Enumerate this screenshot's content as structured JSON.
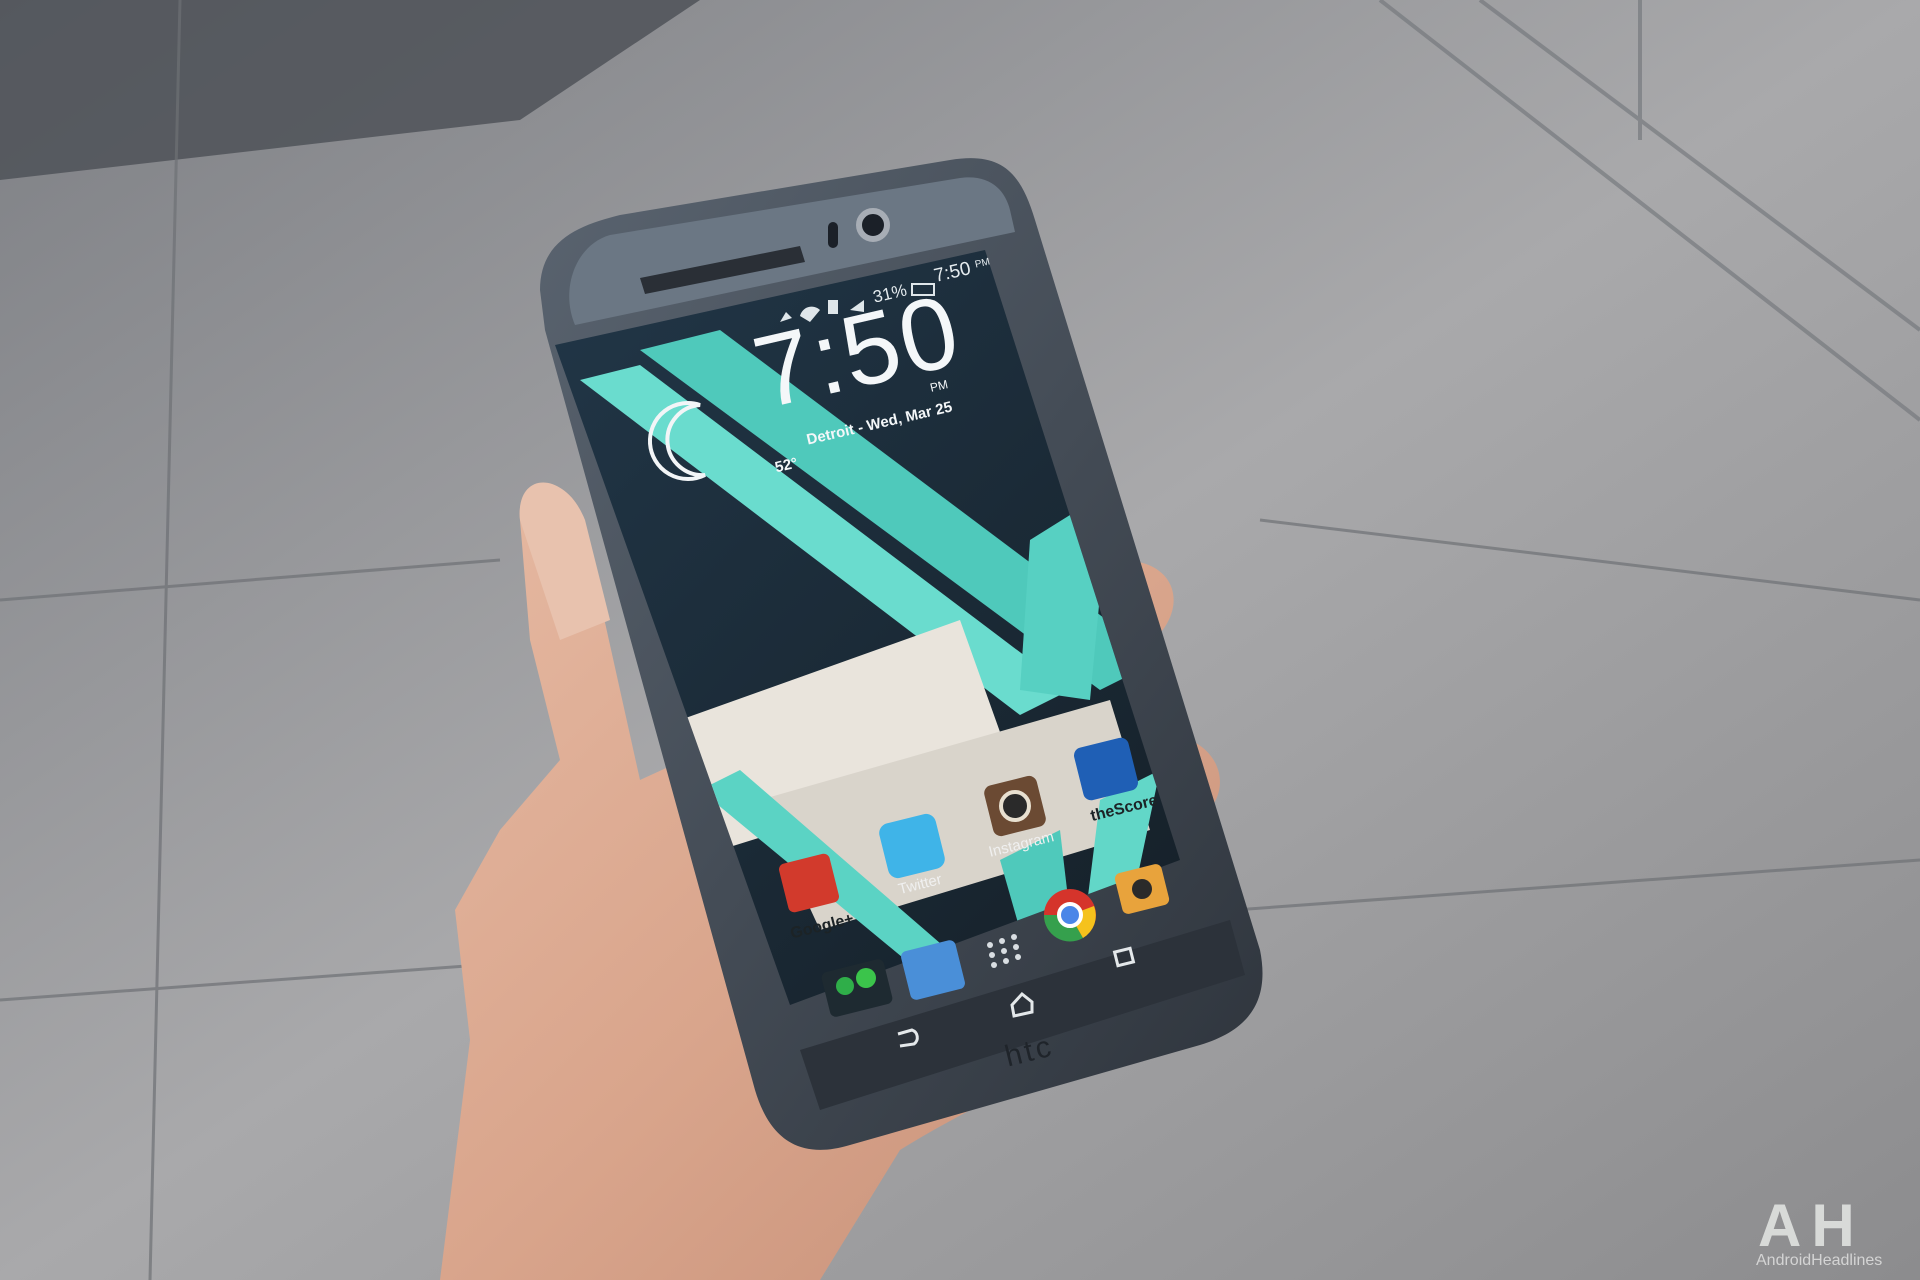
{
  "status_bar": {
    "battery": "31%",
    "time": "7:50",
    "ampm": "PM"
  },
  "clock_widget": {
    "time": "7:50",
    "ampm": "PM",
    "temperature": "52°",
    "location_date": "Detroit - Wed, Mar 25",
    "weather_icon": "crescent-moon-icon"
  },
  "apps": [
    {
      "label": "Google+",
      "icon": "google-plus-icon",
      "color": "#d23a2c"
    },
    {
      "label": "Twitter",
      "icon": "twitter-icon",
      "color": "#3fb4e8"
    },
    {
      "label": "Instagram",
      "icon": "instagram-icon",
      "color": "#6b4a33"
    },
    {
      "label": "theScore",
      "icon": "thescore-icon",
      "color": "#1f5fb5"
    }
  ],
  "dock": [
    {
      "label": "",
      "icon": "messaging-folder-icon"
    },
    {
      "label": "",
      "icon": "inbox-icon"
    },
    {
      "label": "",
      "icon": "app-drawer-icon"
    },
    {
      "label": "",
      "icon": "chrome-icon"
    },
    {
      "label": "",
      "icon": "camera-icon"
    }
  ],
  "nav_bar": [
    "back-icon",
    "home-icon",
    "recents-icon"
  ],
  "device_brand": "htc",
  "watermark": {
    "letters": "AH",
    "tagline": "AndroidHeadlines"
  },
  "colors": {
    "wallpaper_teal": "#5fd8c8",
    "wallpaper_dark": "#1c2a35",
    "phone_body": "#3e4652"
  }
}
